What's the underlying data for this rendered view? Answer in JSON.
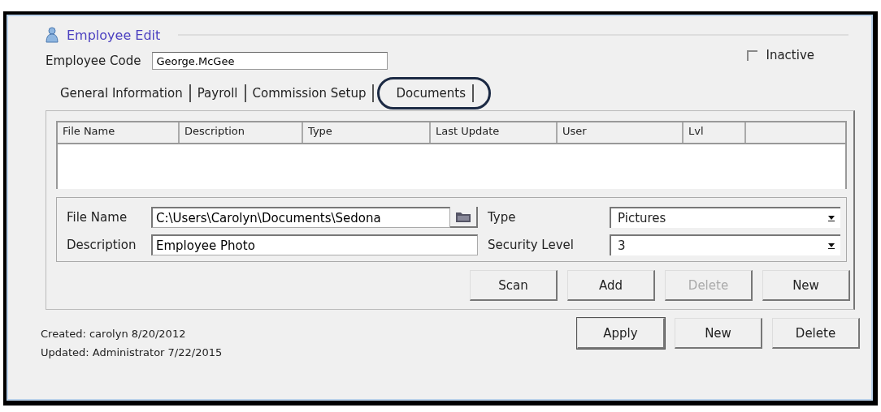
{
  "window": {
    "title": "Employee Edit"
  },
  "employee_code": {
    "label": "Employee Code",
    "value": "George.McGee"
  },
  "inactive": {
    "label": "Inactive",
    "checked": false
  },
  "tabs": [
    {
      "label": "General Information",
      "selected": false
    },
    {
      "label": "Payroll",
      "selected": false
    },
    {
      "label": "Commission Setup",
      "selected": false
    },
    {
      "label": "Documents",
      "selected": true
    }
  ],
  "documents_table": {
    "columns": [
      "File Name",
      "Description",
      "Type",
      "Last Update",
      "User",
      "Lvl"
    ]
  },
  "document_form": {
    "file_name": {
      "label": "File Name",
      "value": "C:\\Users\\Carolyn\\Documents\\Sedona"
    },
    "description": {
      "label": "Description",
      "value": "Employee Photo"
    },
    "type": {
      "label": "Type",
      "value": "Pictures"
    },
    "security_level": {
      "label": "Security Level",
      "value": "3"
    }
  },
  "document_buttons": [
    {
      "label": "Scan",
      "disabled": false
    },
    {
      "label": "Add",
      "disabled": false
    },
    {
      "label": "Delete",
      "disabled": true
    },
    {
      "label": "New",
      "disabled": false
    }
  ],
  "status": {
    "created": "Created: carolyn 8/20/2012",
    "updated": "Updated: Administrator 7/22/2015"
  },
  "buttons": [
    {
      "label": "Apply",
      "disabled": false
    },
    {
      "label": "New",
      "disabled": false
    },
    {
      "label": "Delete",
      "disabled": false
    }
  ]
}
